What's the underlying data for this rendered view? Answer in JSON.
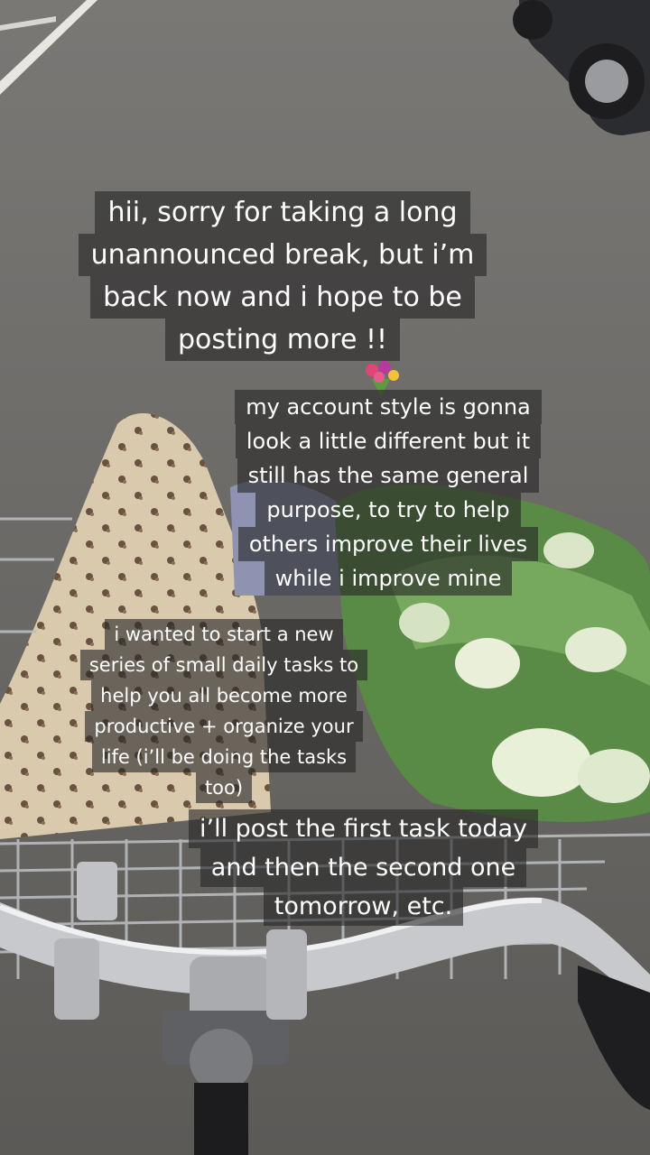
{
  "captions": {
    "c1": [
      "hii, sorry for taking a long",
      "unannounced break, but i’m",
      "back now and i hope to be",
      "posting more !!"
    ],
    "c2": [
      "my account style is gonna",
      "look a little different but it",
      "still has the same general",
      "purpose, to try to help",
      "others improve their lives",
      "while i improve mine"
    ],
    "c3": [
      "i wanted to start a new",
      "series of small daily tasks to",
      "help you all become more",
      "productive + organize your",
      "life (i’ll be doing the tasks",
      "too)"
    ],
    "c4": [
      "i’ll post the first task today",
      "and then the second one",
      "tomorrow, etc."
    ]
  },
  "icons": {
    "sticker": "flower-bouquet-icon"
  },
  "colors": {
    "caption_bg": "#262626",
    "caption_text": "#ffffff",
    "road": "#6e6c69"
  }
}
